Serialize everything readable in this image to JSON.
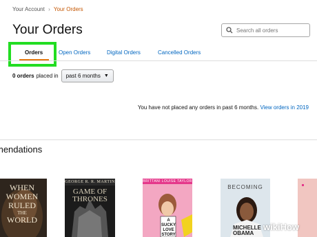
{
  "breadcrumb": {
    "root": "Your Account",
    "separator": "›",
    "current": "Your Orders"
  },
  "page_title": "Your Orders",
  "search": {
    "placeholder": "Search all orders"
  },
  "tabs": [
    {
      "label": "Orders",
      "active": true
    },
    {
      "label": "Open Orders",
      "active": false
    },
    {
      "label": "Digital Orders",
      "active": false
    },
    {
      "label": "Cancelled Orders",
      "active": false
    }
  ],
  "filter": {
    "count": "0 orders",
    "placed_in": "placed in",
    "period": "past 6 months"
  },
  "empty_state": {
    "message": "You have not placed any orders in past 6 months.",
    "link": "View orders in 2019"
  },
  "recommendations": {
    "heading": "mendations",
    "books": [
      {
        "title_lines": [
          "WHEN",
          "WOMEN",
          "RULED",
          "THE",
          "WORLD"
        ]
      },
      {
        "author": "GEORGE R. R. MARTIN",
        "title": "GAME OF THRONES"
      },
      {
        "author": "BRITTANI LOUISE TAYLOR",
        "title": "A SUCKY LOVE STORY"
      },
      {
        "title": "BECOMING",
        "author": "MICHELLE OBAMA"
      },
      {
        "title": ""
      }
    ]
  },
  "watermark": "wikiHow",
  "colors": {
    "link": "#0066c0",
    "accent_orange": "#e47911",
    "highlight_green": "#22dd22",
    "breadcrumb_current": "#c45500"
  }
}
